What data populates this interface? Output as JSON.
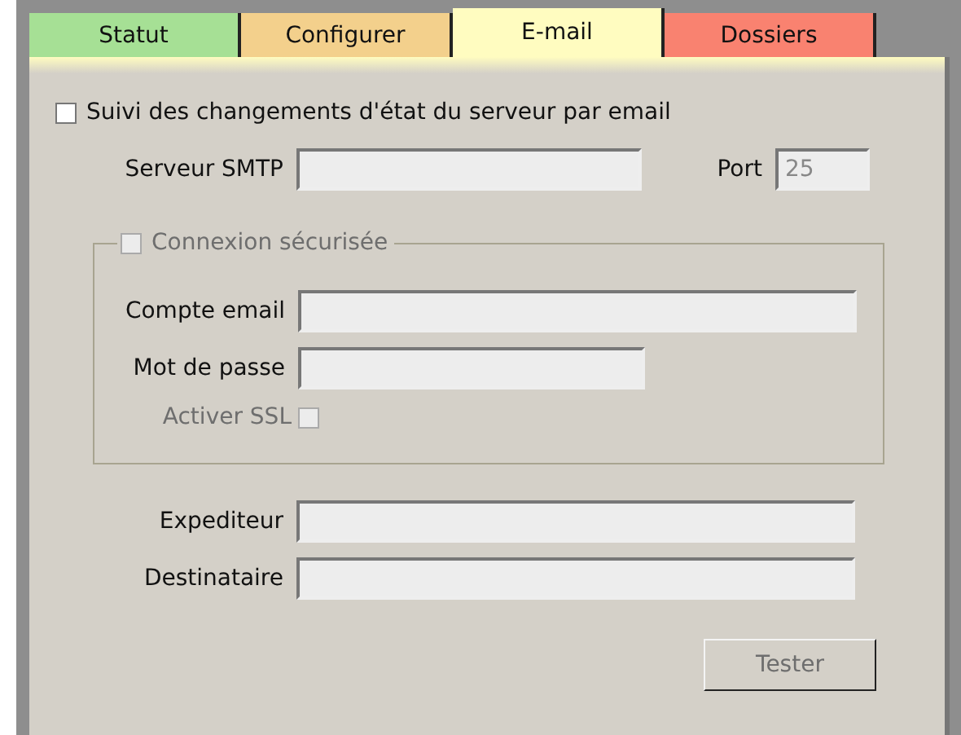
{
  "tabs": [
    {
      "label": "Statut",
      "selected": false,
      "color": "#a6e095"
    },
    {
      "label": "Configurer",
      "selected": false,
      "color": "#f3d08c"
    },
    {
      "label": "E-mail",
      "selected": true,
      "color": "#fffcc0"
    },
    {
      "label": "Dossiers",
      "selected": false,
      "color": "#f98270"
    }
  ],
  "monitor": {
    "label": "Suivi des changements d'état du serveur par email",
    "checked": false
  },
  "smtp": {
    "label": "Serveur SMTP"
  },
  "port": {
    "label": "Port",
    "value": "25",
    "disabled": true
  },
  "secure": {
    "label": "Connexion sécurisée",
    "checked": false,
    "disabled": true,
    "fields": [
      {
        "label": "Compte email",
        "wide": true
      },
      {
        "label": "Mot de passe",
        "wide": false
      }
    ],
    "ssl": {
      "label": "Activer SSL",
      "checked": false,
      "disabled": true
    }
  },
  "addresses": [
    {
      "label": "Expediteur"
    },
    {
      "label": "Destinataire"
    }
  ],
  "test_button": {
    "label": "Tester",
    "disabled": true
  }
}
